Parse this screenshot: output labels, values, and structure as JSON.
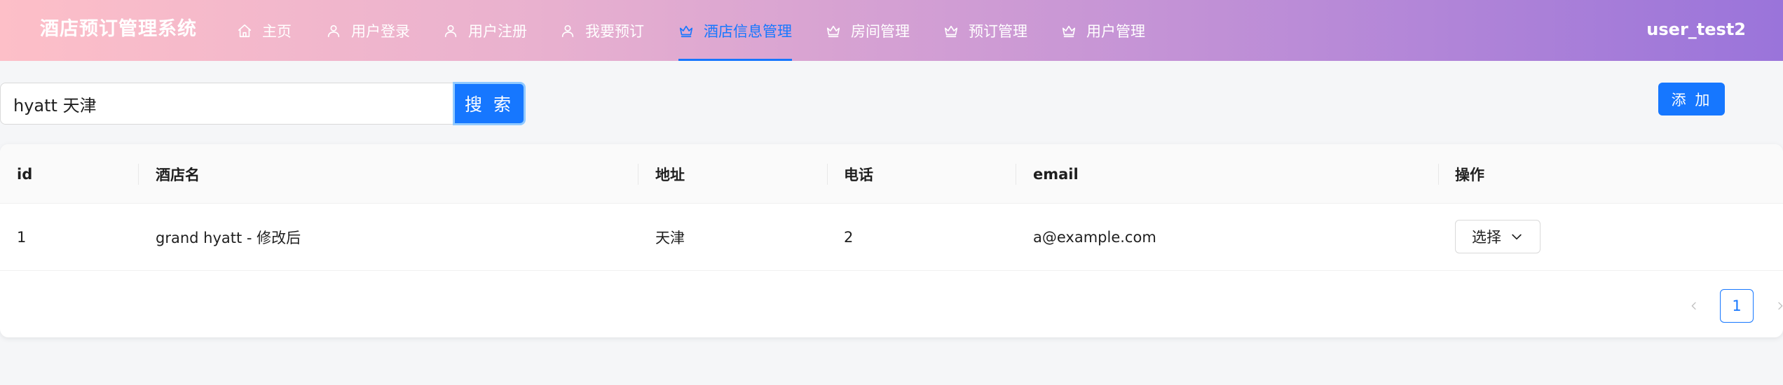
{
  "header": {
    "brand": "酒店预订管理系统",
    "username": "user_test2",
    "active_color": "#1677ff",
    "nav": [
      {
        "label": "主页",
        "icon": "home-icon"
      },
      {
        "label": "用户登录",
        "icon": "user-icon"
      },
      {
        "label": "用户注册",
        "icon": "user-icon"
      },
      {
        "label": "我要预订",
        "icon": "user-icon"
      },
      {
        "label": "酒店信息管理",
        "icon": "crown-icon",
        "active": true
      },
      {
        "label": "房间管理",
        "icon": "crown-icon"
      },
      {
        "label": "预订管理",
        "icon": "crown-icon"
      },
      {
        "label": "用户管理",
        "icon": "crown-icon"
      }
    ]
  },
  "toolbar": {
    "search_value": "hyatt 天津",
    "search_button": "搜 索",
    "add_button": "添 加"
  },
  "table": {
    "columns": [
      "id",
      "酒店名",
      "地址",
      "电话",
      "email",
      "操作"
    ],
    "rows": [
      {
        "id": "1",
        "name": "grand hyatt - 修改后",
        "address": "天津",
        "phone": "2",
        "email": "a@example.com",
        "action": "选择"
      }
    ]
  },
  "pagination": {
    "current": "1"
  }
}
